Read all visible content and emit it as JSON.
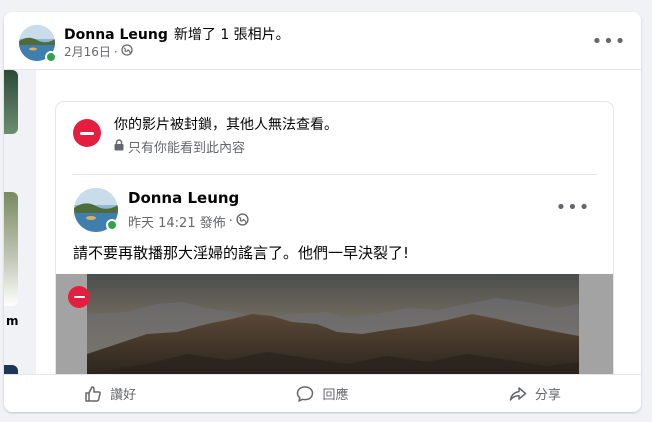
{
  "outer_post": {
    "author": "Donna Leung",
    "action_text": "新增了 1 張相片。",
    "date": "2月16日",
    "separator": "·",
    "more_icon": "more-horizontal-icon"
  },
  "blocked_notice": {
    "title": "你的影片被封鎖，其他人無法查看。",
    "subtitle": "只有你能看到此內容"
  },
  "inner_post": {
    "author": "Donna Leung",
    "time": "昨天 14:21 發佈",
    "separator": "·",
    "text": "請不要再散播那大淫婦的謠言了。他們一早決裂了!"
  },
  "left_strip": {
    "label": "m"
  },
  "action_bar": {
    "like": "讚好",
    "comment": "回應",
    "share": "分享"
  },
  "colors": {
    "online": "#31a24c",
    "blocked": "#e41e3f",
    "secondary_text": "#65676b"
  }
}
